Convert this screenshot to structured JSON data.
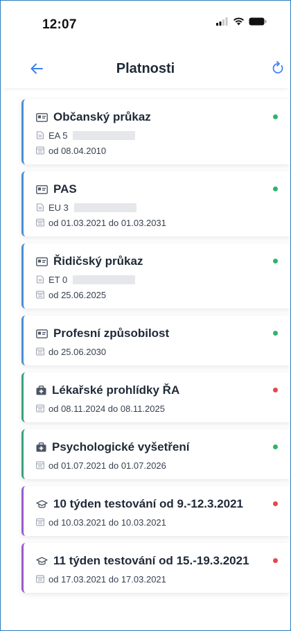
{
  "status_bar": {
    "time": "12:07"
  },
  "header": {
    "title": "Platnosti"
  },
  "colors": {
    "accent": "#4a8fd6",
    "ok": "#2fb36b",
    "expired": "#e5484d"
  },
  "items": [
    {
      "title": "Občanský průkaz",
      "icon": "id-card-icon",
      "number": "EA 5",
      "date": "od 08.04.2010",
      "status": "ok",
      "category": "document"
    },
    {
      "title": "PAS",
      "icon": "id-card-icon",
      "number": "EU 3",
      "date": "od 01.03.2021 do 01.03.2031",
      "status": "ok",
      "category": "document"
    },
    {
      "title": "Řidičský průkaz",
      "icon": "id-card-icon",
      "number": "ET 0",
      "date": "od 25.06.2025",
      "status": "ok",
      "category": "document"
    },
    {
      "title": "Profesní způsobilost",
      "icon": "id-card-icon",
      "date": "do 25.06.2030",
      "status": "ok",
      "category": "document"
    },
    {
      "title": "Lékařské prohlídky ŘA",
      "icon": "medical-kit-icon",
      "date": "od 08.11.2024 do 08.11.2025",
      "status": "expired",
      "category": "medical"
    },
    {
      "title": "Psychologické vyšetření",
      "icon": "medical-kit-icon",
      "date": "od 01.07.2021 do 01.07.2026",
      "status": "ok",
      "category": "medical"
    },
    {
      "title": "10 týden testování od 9.-12.3.2021",
      "icon": "graduation-cap-icon",
      "date": "od 10.03.2021 do 10.03.2021",
      "status": "expired",
      "category": "training"
    },
    {
      "title": "11 týden testování od 15.-19.3.2021",
      "icon": "graduation-cap-icon",
      "date": "od 17.03.2021 do 17.03.2021",
      "status": "expired",
      "category": "training"
    }
  ]
}
